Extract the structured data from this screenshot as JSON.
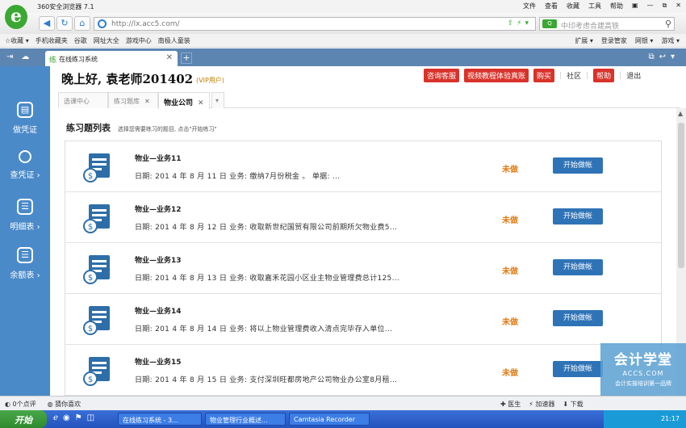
{
  "browser": {
    "app_title": "360安全浏览器 7.1",
    "logo_letter": "e",
    "menu": [
      "文件",
      "查看",
      "收藏",
      "工具",
      "帮助",
      "▣",
      "—",
      "⧉",
      "✕"
    ],
    "url": "http://lx.acc5.com/",
    "search_placeholder": "中印考虑合建高铁",
    "search_engine": "Q",
    "favorites": [
      "☆收藏 ▾",
      "手机收藏夹",
      "谷歌",
      "网址大全",
      "游戏中心",
      "南极人童装"
    ],
    "fav_right": [
      "扩展 ▾",
      "登录管家",
      "网银 ▾",
      "游戏 ▾"
    ],
    "tab_title": "在线练习系统",
    "tab_close": "✕",
    "tab_new": "+"
  },
  "sidebar": {
    "items": [
      {
        "label": "做凭证",
        "icon": "voucher-icon"
      },
      {
        "label": "查凭证 ›",
        "icon": "search-icon"
      },
      {
        "label": "明细表 ›",
        "icon": "list-icon"
      },
      {
        "label": "余额表 ›",
        "icon": "balance-icon"
      }
    ]
  },
  "header": {
    "greeting": "晚上好, 袁老师201402",
    "vip": "(VIP用户)",
    "buttons": [
      "咨询客服",
      "视频教程体验真账",
      "购买"
    ],
    "links": [
      "社区"
    ],
    "help": "帮助",
    "logout": "退出"
  },
  "subtabs": [
    {
      "label": "选课中心",
      "active": false
    },
    {
      "label": "练习题库",
      "active": false,
      "close": "✕"
    },
    {
      "label": "物业公司",
      "active": true,
      "close": "✕"
    }
  ],
  "subtab_more": "▾",
  "list": {
    "title": "练习题列表",
    "hint": "选择您需要练习的题目, 点击\"开始练习\"",
    "rows": [
      {
        "title": "物业—业务11",
        "desc": "日期:  201 4 年 8 月 11 日 业务:  缴纳7月份税金 。 单据: ...",
        "status": "未做",
        "action": "开始做帐"
      },
      {
        "title": "物业—业务12",
        "desc": "日期:  201 4 年 8 月 12 日 业务:  收取新世纪国贸有限公司前期所欠物业费5...",
        "status": "未做",
        "action": "开始做帐"
      },
      {
        "title": "物业—业务13",
        "desc": "日期:  201 4 年 8 月 13 日 业务:  收取嘉禾花园小区业主物业管理费总计125...",
        "status": "未做",
        "action": "开始做帐"
      },
      {
        "title": "物业—业务14",
        "desc": "日期:  201 4 年 8 月 14 日 业务:  将以上物业管理费收入清点完毕存入单位...",
        "status": "未做",
        "action": "开始做帐"
      },
      {
        "title": "物业—业务15",
        "desc": "日期:  201 4 年 8 月 15 日 业务:  支付深圳旺都房地产公司物业办公室8月租...",
        "status": "未做",
        "action": "开始做帐"
      }
    ]
  },
  "watermark": {
    "brand": "会计学堂",
    "url": "ACCS.COM",
    "slogan": "会计实操培训第一品牌"
  },
  "statusbar": {
    "left": [
      "◐ 0个点评",
      "◍ 猜你喜欢"
    ],
    "right": [
      "✚ 医生",
      "⚡ 加速器",
      "⬇ 下载"
    ]
  },
  "taskbar": {
    "start": "开始",
    "tasks": [
      "在线练习系统 - 3...",
      "物业管理行业概述...",
      "Camtasia Recorder"
    ],
    "clock": "21:17"
  },
  "colors": {
    "sidebar": "#4a8ac9",
    "tabbar": "#5c85b1",
    "status_pending": "#e27a13",
    "action_button": "#2f73b7",
    "red_button": "#d9322a"
  }
}
